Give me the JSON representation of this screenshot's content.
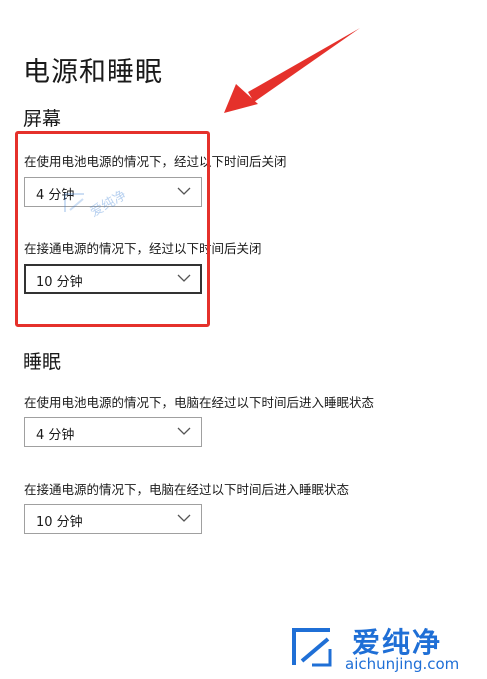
{
  "page_title": "电源和睡眠",
  "screen": {
    "title": "屏幕",
    "battery_label": "在使用电池电源的情况下，经过以下时间后关闭",
    "battery_value": "4 分钟",
    "plugged_label": "在接通电源的情况下，经过以下时间后关闭",
    "plugged_value": "10 分钟"
  },
  "sleep": {
    "title": "睡眠",
    "battery_label": "在使用电池电源的情况下，电脑在经过以下时间后进入睡眠状态",
    "battery_value": "4 分钟",
    "plugged_label": "在接通电源的情况下，电脑在经过以下时间后进入睡眠状态",
    "plugged_value": "10 分钟"
  },
  "annotation_color": "#e5312b",
  "watermark": {
    "small_text": "爱纯净",
    "brand": "爱纯净",
    "url": "aichunjing.com",
    "brand_color": "#1f6fd6"
  }
}
